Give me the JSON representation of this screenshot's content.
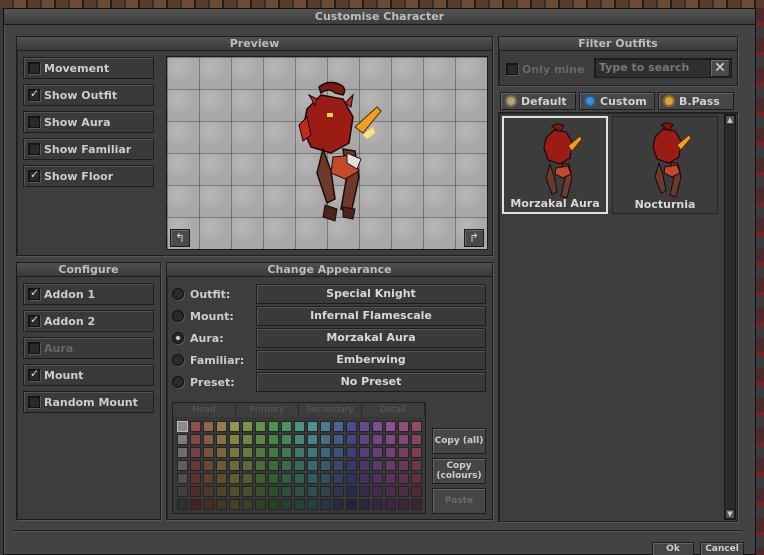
{
  "window": {
    "title": "Customise Character"
  },
  "preview": {
    "title": "Preview",
    "options": [
      {
        "label": "Movement",
        "checked": false
      },
      {
        "label": "Show Outfit",
        "checked": true
      },
      {
        "label": "Show Aura",
        "checked": false
      },
      {
        "label": "Show Familiar",
        "checked": false
      },
      {
        "label": "Show Floor",
        "checked": true
      }
    ]
  },
  "configure": {
    "title": "Configure",
    "options": [
      {
        "label": "Addon 1",
        "checked": true,
        "disabled": false
      },
      {
        "label": "Addon 2",
        "checked": true,
        "disabled": false
      },
      {
        "label": "Aura",
        "checked": false,
        "disabled": true
      },
      {
        "label": "Mount",
        "checked": true,
        "disabled": false
      },
      {
        "label": "Random Mount",
        "checked": false,
        "disabled": false
      }
    ]
  },
  "appearance": {
    "title": "Change Appearance",
    "rows": [
      {
        "label": "Outfit:",
        "value": "Special Knight",
        "selected": false
      },
      {
        "label": "Mount:",
        "value": "Infernal Flamescale",
        "selected": false
      },
      {
        "label": "Aura:",
        "value": "Morzakal Aura",
        "selected": true
      },
      {
        "label": "Familiar:",
        "value": "Emberwing",
        "selected": false
      },
      {
        "label": "Preset:",
        "value": "No Preset",
        "selected": false
      }
    ],
    "palette_tabs": [
      "Head",
      "Primary",
      "Secondary",
      "Detail"
    ],
    "copy_all": "Copy (all)",
    "copy_colours": "Copy (colours)",
    "paste": "Paste"
  },
  "filter": {
    "title": "Filter Outfits",
    "only_mine": "Only mine",
    "search_placeholder": "Type to search",
    "tabs": [
      {
        "label": "Default",
        "icon": "coin-icon",
        "color": "#b9a27a"
      },
      {
        "label": "Custom",
        "icon": "custom-coin-icon",
        "color": "#3d8fd6"
      },
      {
        "label": "B.Pass",
        "icon": "battle-pass-icon",
        "color": "#d9a23a"
      }
    ],
    "outfits": [
      {
        "name": "Morzakal Aura",
        "selected": true
      },
      {
        "name": "Nocturnia",
        "selected": false
      }
    ]
  },
  "footer": {
    "ok": "Ok",
    "cancel": "Cancel"
  },
  "colors": {
    "accent_red": "#b01818",
    "panel_bg": "#3d3d3d"
  }
}
